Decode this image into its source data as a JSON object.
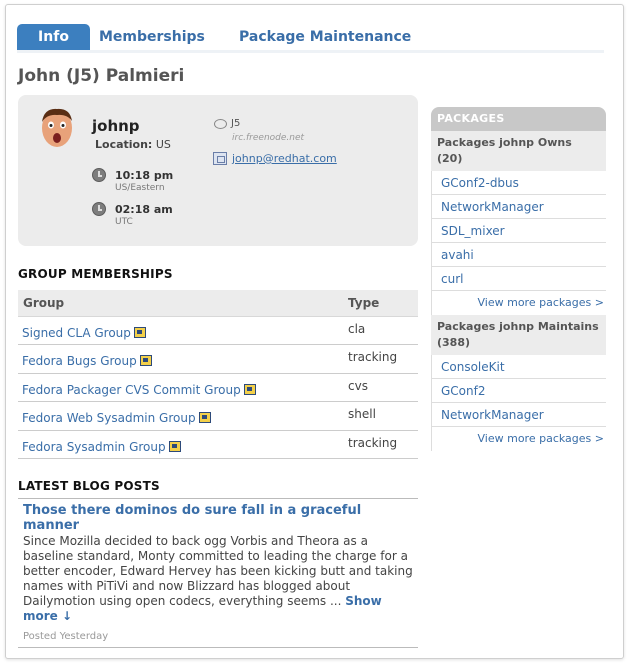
{
  "tabs": [
    {
      "label": "Info"
    },
    {
      "label": "Memberships"
    },
    {
      "label": "Package Maintenance"
    }
  ],
  "page_title": "John (J5) Palmieri",
  "profile": {
    "username": "johnp",
    "location_label": "Location:",
    "location_value": "US",
    "times": [
      {
        "time": "10:18 pm",
        "tz": "US/Eastern"
      },
      {
        "time": "02:18 am",
        "tz": "UTC"
      }
    ],
    "irc_nick": "J5",
    "irc_server": "irc.freenode.net",
    "email": "johnp@redhat.com"
  },
  "groups": {
    "heading": "GROUP MEMBERSHIPS",
    "columns": [
      "Group",
      "Type"
    ],
    "rows": [
      {
        "name": "Signed CLA Group",
        "type": "cla"
      },
      {
        "name": "Fedora Bugs Group",
        "type": "tracking"
      },
      {
        "name": "Fedora Packager CVS Commit Group",
        "type": "cvs"
      },
      {
        "name": "Fedora Web Sysadmin Group",
        "type": "shell"
      },
      {
        "name": "Fedora Sysadmin Group",
        "type": "tracking"
      }
    ]
  },
  "blog": {
    "heading": "LATEST BLOG POSTS",
    "title": "Those there dominos do sure fall in a graceful manner",
    "body": "Since Mozilla decided to back ogg Vorbis and Theora as a baseline standard, Monty committed to leading the charge for a better encoder, Edward Hervey has been kicking butt and taking names with PiTiVi and now Blizzard has blogged about Dailymotion using open codecs, everything seems ...",
    "more": "Show more ↓",
    "posted": "Posted Yesterday"
  },
  "packages": {
    "heading": "PACKAGES",
    "owns_label": "Packages johnp Owns (20)",
    "owns": [
      "GConf2-dbus",
      "NetworkManager",
      "SDL_mixer",
      "avahi",
      "curl"
    ],
    "owns_more": "View more packages >",
    "maintains_label": "Packages johnp Maintains (388)",
    "maintains": [
      "ConsoleKit",
      "GConf2",
      "NetworkManager"
    ],
    "maintains_more": "View more packages >"
  }
}
